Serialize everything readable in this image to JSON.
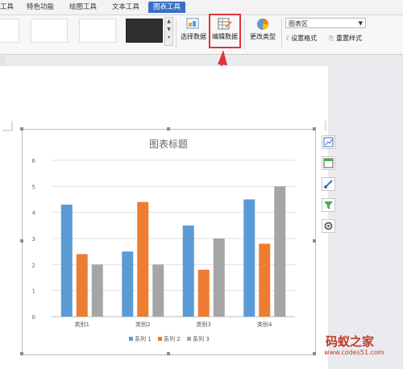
{
  "tabs": [
    "工具",
    "特色功能",
    "绘图工具",
    "文本工具",
    "图表工具"
  ],
  "active_tab_index": 4,
  "ribbon": {
    "select_data": "选择数据",
    "edit_data": "编辑数据",
    "change_type": "更改类型",
    "chart_area_value": "图表区",
    "set_format": "设置格式",
    "reset_style": "重置样式"
  },
  "colors": {
    "series1": "#5b9bd5",
    "series2": "#ed7d31",
    "series3": "#a5a5a5",
    "highlight": "#e0343a",
    "active_tab": "#3b6fc4"
  },
  "watermark": {
    "line1": "码蚁之家",
    "line2": "www.codes51.com"
  },
  "side_tools": [
    "chart-elements-icon",
    "chart-style-icon",
    "paint-brush-icon",
    "filter-icon",
    "settings-icon"
  ],
  "chart_data": {
    "type": "bar",
    "title": "图表标题",
    "categories": [
      "类别1",
      "类别2",
      "类别3",
      "类别4"
    ],
    "series": [
      {
        "name": "系列 1",
        "values": [
          4.3,
          2.5,
          3.5,
          4.5
        ]
      },
      {
        "name": "系列 2",
        "values": [
          2.4,
          4.4,
          1.8,
          2.8
        ]
      },
      {
        "name": "系列 3",
        "values": [
          2,
          2,
          3,
          5
        ]
      }
    ],
    "ylim": [
      0,
      6
    ],
    "yticks": [
      "0",
      "1",
      "2",
      "3",
      "4",
      "5",
      "6"
    ],
    "grid": true,
    "legend": "bottom"
  }
}
